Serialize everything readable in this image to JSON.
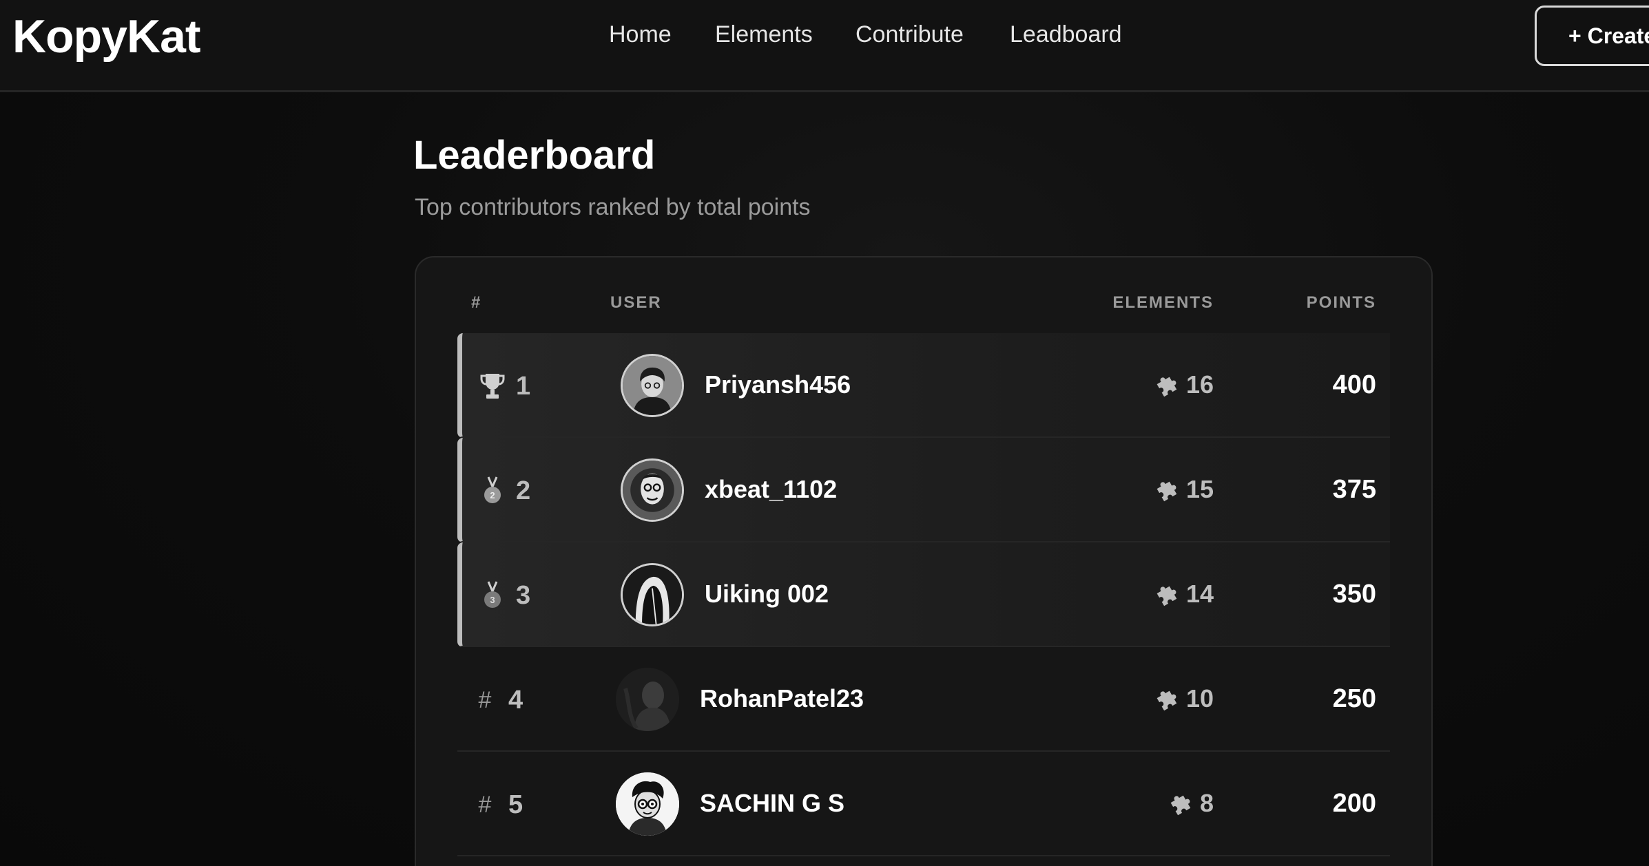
{
  "app": {
    "logo": "KopyKat"
  },
  "nav": {
    "items": [
      {
        "label": "Home"
      },
      {
        "label": "Elements"
      },
      {
        "label": "Contribute"
      },
      {
        "label": "Leadboard"
      }
    ],
    "create_label": "+ Create"
  },
  "page": {
    "title": "Leaderboard",
    "subtitle": "Top contributors ranked by total points"
  },
  "table": {
    "columns": {
      "rank": "#",
      "user": "USER",
      "elements": "ELEMENTS",
      "points": "POINTS"
    },
    "rows": [
      {
        "rank": "1",
        "rank_icon": "trophy-icon",
        "username": "Priyansh456",
        "elements": "16",
        "points": "400"
      },
      {
        "rank": "2",
        "rank_icon": "silver-medal-icon",
        "username": "xbeat_1102",
        "elements": "15",
        "points": "375"
      },
      {
        "rank": "3",
        "rank_icon": "bronze-medal-icon",
        "username": "Uiking 002",
        "elements": "14",
        "points": "350"
      },
      {
        "rank": "4",
        "rank_icon": "hash-icon",
        "hash": "#",
        "username": "RohanPatel23",
        "elements": "10",
        "points": "250"
      },
      {
        "rank": "5",
        "rank_icon": "hash-icon",
        "hash": "#",
        "username": "SACHIN G S",
        "elements": "8",
        "points": "200"
      }
    ]
  },
  "colors": {
    "background": "#0b0b0b",
    "card": "#161616",
    "accent": "#ffffff",
    "muted": "#9a9a9a"
  }
}
